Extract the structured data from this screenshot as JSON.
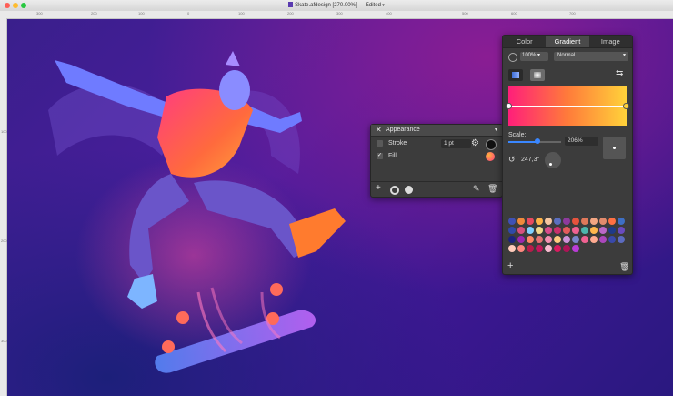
{
  "window": {
    "title": "Skate.afdesign [270.00%] — Edited"
  },
  "ruler": {
    "h_ticks": [
      "300",
      "200",
      "100",
      "0",
      "100",
      "200",
      "300",
      "400",
      "500",
      "600",
      "700"
    ],
    "v_ticks": [
      "100",
      "200",
      "300"
    ]
  },
  "appearance": {
    "title": "Appearance",
    "stroke": {
      "label": "Stroke",
      "width": "1 pt",
      "checked": false
    },
    "fill": {
      "label": "Fill",
      "checked": true
    }
  },
  "gradient_panel": {
    "tabs": [
      "Color",
      "Gradient",
      "Image"
    ],
    "active_tab": "Gradient",
    "opacity": "100%",
    "blend_mode": "Normal",
    "scale_label": "Scale:",
    "scale_value": "206%",
    "scale_level": 0.55,
    "rotation": "247,3°",
    "gradient_colors": [
      "#ff1f7a",
      "#ff7b3a",
      "#ffd23a"
    ]
  },
  "swatches": [
    [
      "#3f51b5",
      "#f08a3c",
      "#e84a5f",
      "#ffb347",
      "#f5c6a0",
      "#5b6fbf",
      "#8e3a9d",
      "#e5533d",
      "#e0785a",
      "#f3a683",
      "#e28b6d",
      "#ff7043",
      "#3e6fc4"
    ],
    [
      "#2f4aa8",
      "#d6517d",
      "#7fd1ff",
      "#f2d98c",
      "#d94b8a",
      "#c9306b",
      "#e45b5b",
      "#f06292",
      "#4db6ac",
      "#ffb74d",
      "#ba68c8",
      "#1e3a8a",
      "#6a4bbf"
    ],
    [
      "#1a237e",
      "#9c27b0",
      "#ff8a65",
      "#e57373",
      "#f48fb1",
      "#ffcc80",
      "#ce93d8",
      "#7986cb",
      "#f06292",
      "#ffab91",
      "#ab47bc",
      "#3949ab",
      "#5c6bc0"
    ],
    [
      "#ffccbc",
      "#ff8a80",
      "#b71c4a",
      "#c2185b",
      "#f8bbd0",
      "#d81b60",
      "#ad1457",
      "#ba3cd6"
    ]
  ]
}
